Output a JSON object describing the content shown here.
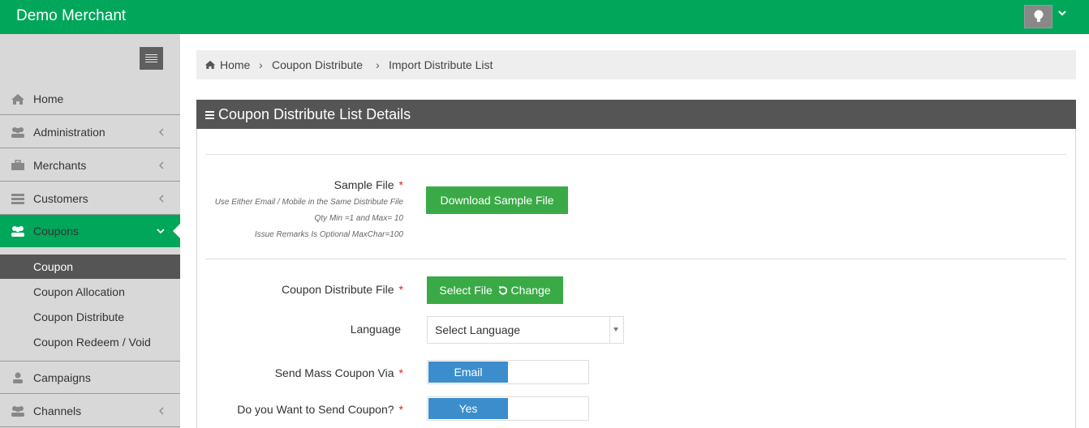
{
  "app": {
    "title": "Demo Merchant"
  },
  "topbar": {
    "user_icon": "lightbulb-icon",
    "caret_icon": "chevron-down-icon"
  },
  "sidebar": {
    "items": [
      {
        "label": "Home",
        "icon": "home-icon"
      },
      {
        "label": "Administration",
        "icon": "users-icon"
      },
      {
        "label": "Merchants",
        "icon": "briefcase-icon"
      },
      {
        "label": "Customers",
        "icon": "list-icon"
      },
      {
        "label": "Coupons",
        "icon": "users-icon",
        "active": true
      },
      {
        "label": "Campaigns",
        "icon": "user-icon"
      },
      {
        "label": "Channels",
        "icon": "users-icon"
      }
    ],
    "submenu": [
      {
        "label": "Coupon",
        "active": true
      },
      {
        "label": "Coupon Allocation"
      },
      {
        "label": "Coupon Distribute"
      },
      {
        "label": "Coupon Redeem / Void"
      }
    ]
  },
  "breadcrumb": {
    "items": [
      "Home",
      "Coupon Distribute",
      "Import Distribute List"
    ]
  },
  "panel": {
    "title": "Coupon Distribute List Details",
    "sample_file": {
      "label": "Sample File",
      "required_mark": "*",
      "hints": [
        "Use Either Email / Mobile in the Same Distribute File",
        "Qty Min =1 and Max= 10",
        "Issue Remarks Is Optional MaxChar=100"
      ],
      "button": "Download Sample File"
    },
    "distribute_file": {
      "label": "Coupon Distribute File",
      "required_mark": "*",
      "select_label": "Select File",
      "change_label": "Change"
    },
    "language": {
      "label": "Language",
      "placeholder": "Select Language"
    },
    "send_via": {
      "label": "Send Mass Coupon Via",
      "required_mark": "*",
      "value": "Email"
    },
    "send_coupon": {
      "label": "Do you Want to Send Coupon?",
      "required_mark": "*",
      "value": "Yes"
    }
  },
  "colors": {
    "brand_green": "#00a65a",
    "button_green": "#3aaa46",
    "toggle_blue": "#3c8dcb",
    "panel_header": "#555555"
  }
}
